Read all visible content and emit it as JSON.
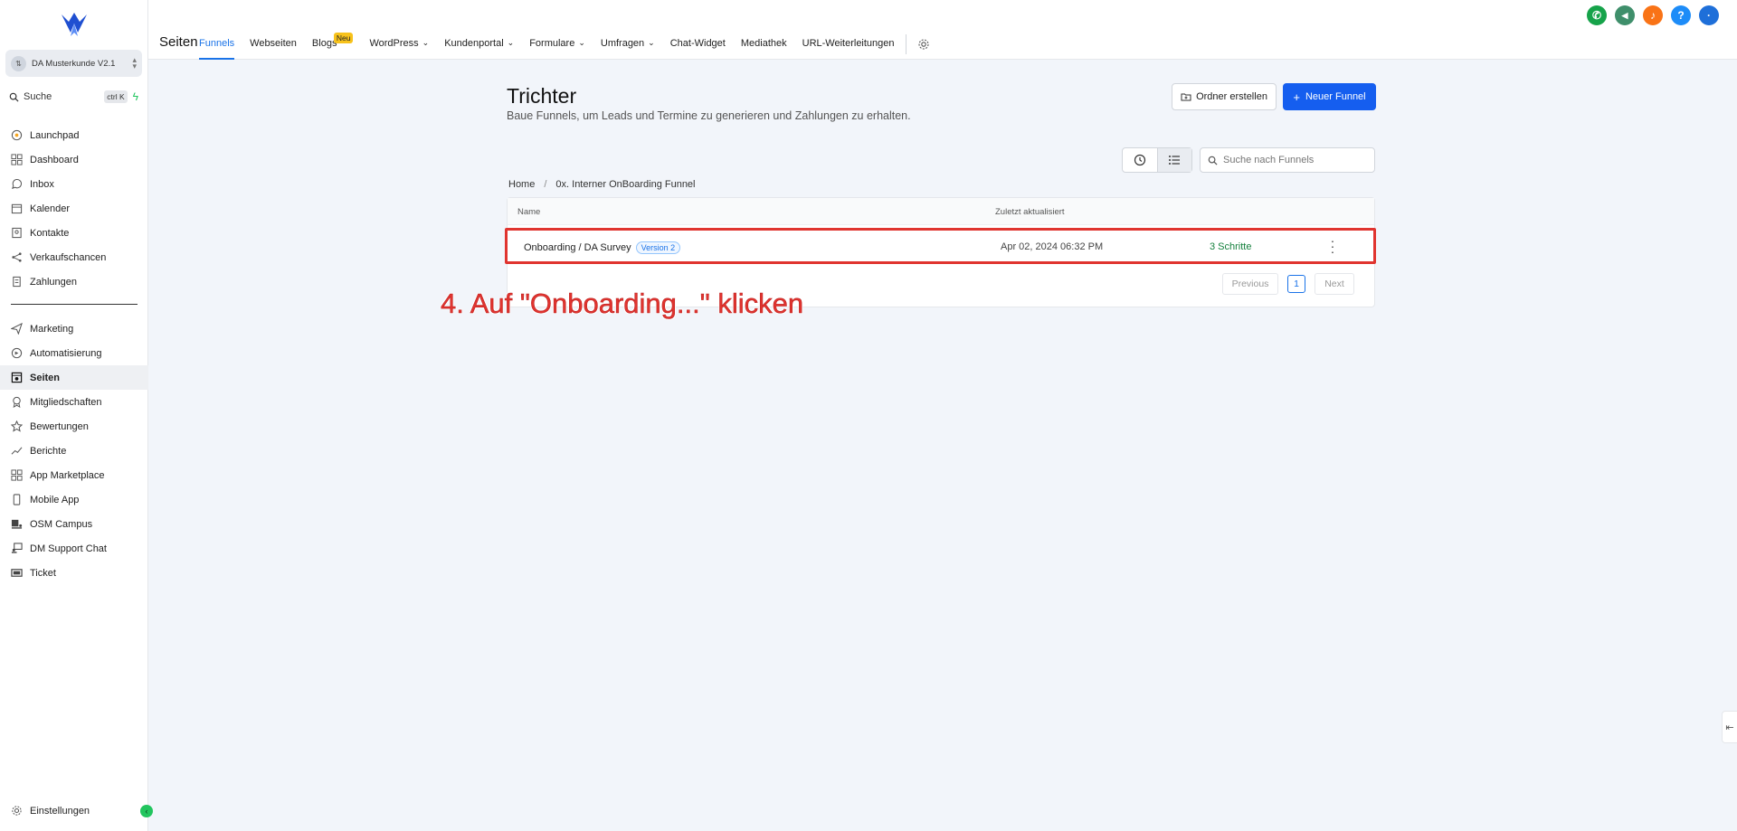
{
  "sidebar": {
    "account_name": "DA Musterkunde V2.1",
    "search_label": "Suche",
    "search_shortcut": "ctrl K",
    "items_top": [
      {
        "label": "Launchpad",
        "icon": "rocket-icon"
      },
      {
        "label": "Dashboard",
        "icon": "grid-icon"
      },
      {
        "label": "Inbox",
        "icon": "chat-icon"
      },
      {
        "label": "Kalender",
        "icon": "calendar-icon"
      },
      {
        "label": "Kontakte",
        "icon": "contacts-icon"
      },
      {
        "label": "Verkaufschancen",
        "icon": "pipeline-icon"
      },
      {
        "label": "Zahlungen",
        "icon": "payment-icon"
      }
    ],
    "items_bottom": [
      {
        "label": "Marketing",
        "icon": "send-icon"
      },
      {
        "label": "Automatisierung",
        "icon": "automation-icon"
      },
      {
        "label": "Seiten",
        "icon": "pages-icon",
        "active": true
      },
      {
        "label": "Mitgliedschaften",
        "icon": "badge-icon"
      },
      {
        "label": "Bewertungen",
        "icon": "star-icon"
      },
      {
        "label": "Berichte",
        "icon": "trend-icon"
      },
      {
        "label": "App Marketplace",
        "icon": "apps-icon"
      },
      {
        "label": "Mobile App",
        "icon": "phone-icon"
      },
      {
        "label": "OSM Campus",
        "icon": "campus-icon"
      },
      {
        "label": "DM Support Chat",
        "icon": "support-icon"
      },
      {
        "label": "Ticket",
        "icon": "ticket-icon"
      }
    ],
    "settings_label": "Einstellungen"
  },
  "topbar": {
    "title": "Seiten",
    "tabs": [
      {
        "label": "Funnels",
        "active": true
      },
      {
        "label": "Webseiten"
      },
      {
        "label": "Blogs",
        "badge": "Neu"
      },
      {
        "label": "WordPress",
        "dropdown": true
      },
      {
        "label": "Kundenportal",
        "dropdown": true
      },
      {
        "label": "Formulare",
        "dropdown": true
      },
      {
        "label": "Umfragen",
        "dropdown": true
      },
      {
        "label": "Chat-Widget"
      },
      {
        "label": "Mediathek"
      },
      {
        "label": "URL-Weiterleitungen"
      }
    ],
    "icons": [
      {
        "name": "phone-icon",
        "color": "#16a34a",
        "glyph": "✆"
      },
      {
        "name": "megaphone-icon",
        "color": "#3f8f6b",
        "glyph": "◀"
      },
      {
        "name": "bell-icon",
        "color": "#f97316",
        "glyph": "♪"
      },
      {
        "name": "help-icon",
        "color": "#1d8cf8",
        "glyph": "?"
      },
      {
        "name": "avatar-icon",
        "color": "#1e6fd9",
        "glyph": "·"
      }
    ]
  },
  "main": {
    "title": "Trichter",
    "subtitle": "Baue Funnels, um Leads und Termine zu generieren und Zahlungen zu erhalten.",
    "create_folder_label": "Ordner erstellen",
    "new_funnel_label": "Neuer Funnel",
    "search_placeholder": "Suche nach Funnels",
    "breadcrumb": [
      "Home",
      "0x. Interner OnBoarding Funnel"
    ],
    "table": {
      "headers": {
        "name": "Name",
        "updated": "Zuletzt aktualisiert"
      },
      "rows": [
        {
          "name": "Onboarding / DA Survey",
          "version": "Version 2",
          "updated": "Apr 02, 2024 06:32 PM",
          "steps": "3 Schritte"
        }
      ]
    },
    "pagination": {
      "previous": "Previous",
      "current": "1",
      "next": "Next"
    }
  },
  "annotation": "4. Auf \"Onboarding...\" klicken",
  "colors": {
    "accent": "#155eef",
    "highlight": "#e0342f",
    "steps": "#15803d"
  }
}
